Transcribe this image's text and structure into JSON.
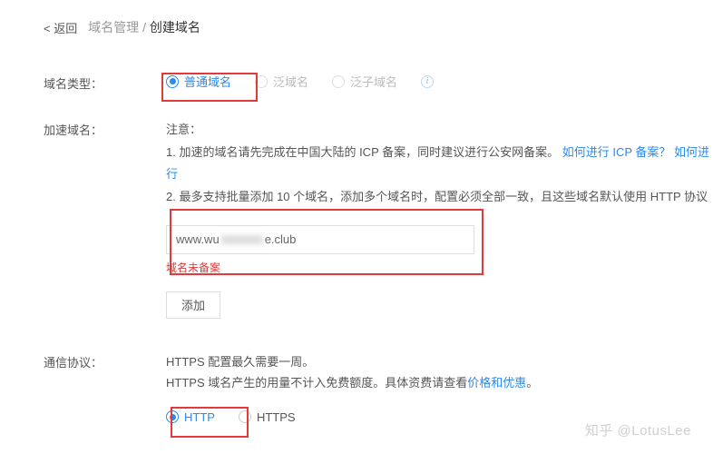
{
  "header": {
    "back": "< 返回",
    "crumb_parent": "域名管理",
    "crumb_sep": " / ",
    "crumb_current": "创建域名"
  },
  "domain_type": {
    "label": "域名类型：",
    "options": {
      "normal": "普通域名",
      "wildcard": "泛域名",
      "sub_wildcard": "泛子域名"
    }
  },
  "accel_domain": {
    "label": "加速域名：",
    "notice_title": "注意：",
    "notice_line1_a": "1. 加速的域名请先完成在中国大陆的 ICP 备案，同时建议进行公安网备案。",
    "notice_link1": "如何进行 ICP 备案？",
    "notice_link2": "如何进行",
    "notice_line2": "2. 最多支持批量添加 10 个域名，添加多个域名时，配置必须全部一致，且这些域名默认使用 HTTP 协议",
    "input_prefix": "www.wu",
    "input_suffix": "e.club",
    "error": "域名未备案",
    "add_btn": "添加"
  },
  "protocol": {
    "label": "通信协议：",
    "note_line1": "HTTPS 配置最久需要一周。",
    "note_line2_a": "HTTPS 域名产生的用量不计入免费额度。具体资费请查看",
    "note_link": "价格和优惠",
    "note_line2_b": "。",
    "options": {
      "http": "HTTP",
      "https": "HTTPS"
    }
  },
  "watermark": "知乎 @LotusLee"
}
